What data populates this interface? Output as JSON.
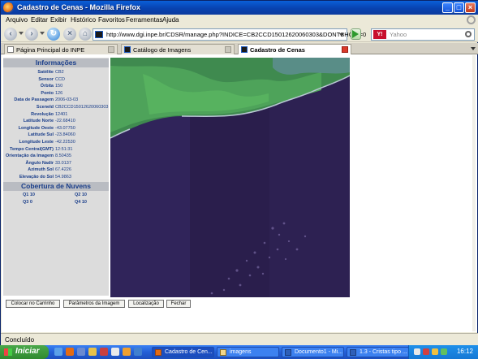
{
  "window": {
    "title": "Cadastro de Cenas - Mozilla Firefox",
    "controls": [
      "_",
      "□",
      "×"
    ]
  },
  "menu": [
    "Arquivo",
    "Editar",
    "Exibir",
    "Histórico",
    "Favoritos",
    "Ferramentas",
    "Ajuda"
  ],
  "navbar": {
    "url": "http://www.dgi.inpe.br/CDSR/manage.php?INDICE=CB2CCD15012620060303&DONTSHOW=0",
    "search_placeholder": "Yahoo",
    "search_engine": "Y!"
  },
  "tabs": [
    {
      "label": "Página Principal do INPE",
      "active": false
    },
    {
      "label": "Catálogo de Imagens",
      "active": false
    },
    {
      "label": "Cadastro de Cenas",
      "active": true
    }
  ],
  "info": {
    "heading": "Informações",
    "rows": [
      {
        "label": "Satélite",
        "value": "CB2"
      },
      {
        "label": "Sensor",
        "value": "CCD"
      },
      {
        "label": "Órbita",
        "value": "150"
      },
      {
        "label": "Ponto",
        "value": "126"
      },
      {
        "label": "Data de Passagem",
        "value": "2006-03-03"
      },
      {
        "label": "SceneId",
        "value": "CB2CCD15012620060303"
      },
      {
        "label": "Revolução",
        "value": "12401"
      },
      {
        "label": "Latitude Norte",
        "value": "-22.68410"
      },
      {
        "label": "Longitude Oeste",
        "value": "-43.07750"
      },
      {
        "label": "Latitude Sul",
        "value": "-23.84060"
      },
      {
        "label": "Longitude Leste",
        "value": "-42.22530"
      },
      {
        "label": "Tempo Central(GMT)",
        "value": "12:51:31"
      },
      {
        "label": "Orientação da Imagem",
        "value": "8.50435"
      },
      {
        "label": "Ângulo Nadir",
        "value": "33.0137"
      },
      {
        "label": "Azimuth Sol",
        "value": "67.4226"
      },
      {
        "label": "Elevação do Sol",
        "value": "54.9863"
      }
    ]
  },
  "clouds": {
    "heading": "Cobertura de Nuvens",
    "q1": "Q1  10",
    "q2": "Q2  10",
    "q3": "Q3  0",
    "q4": "Q4  10"
  },
  "buttons": {
    "cart": "Colocar no Carrinho",
    "params": "Parâmetros da Imagem",
    "locate": "Localização",
    "close": "Fechar"
  },
  "status": "Concluído",
  "taskbar": {
    "start": "Iniciar",
    "tasks": [
      "Cadastro de Cen...",
      "imagens",
      "Documento1 - Mi...",
      "1.3 - Cristas tipo ..."
    ],
    "clock": "16:12"
  },
  "colors": {
    "xp_blue": "#0842b0",
    "info_text": "#1a3e8a",
    "start_green": "#2f8a2f"
  }
}
